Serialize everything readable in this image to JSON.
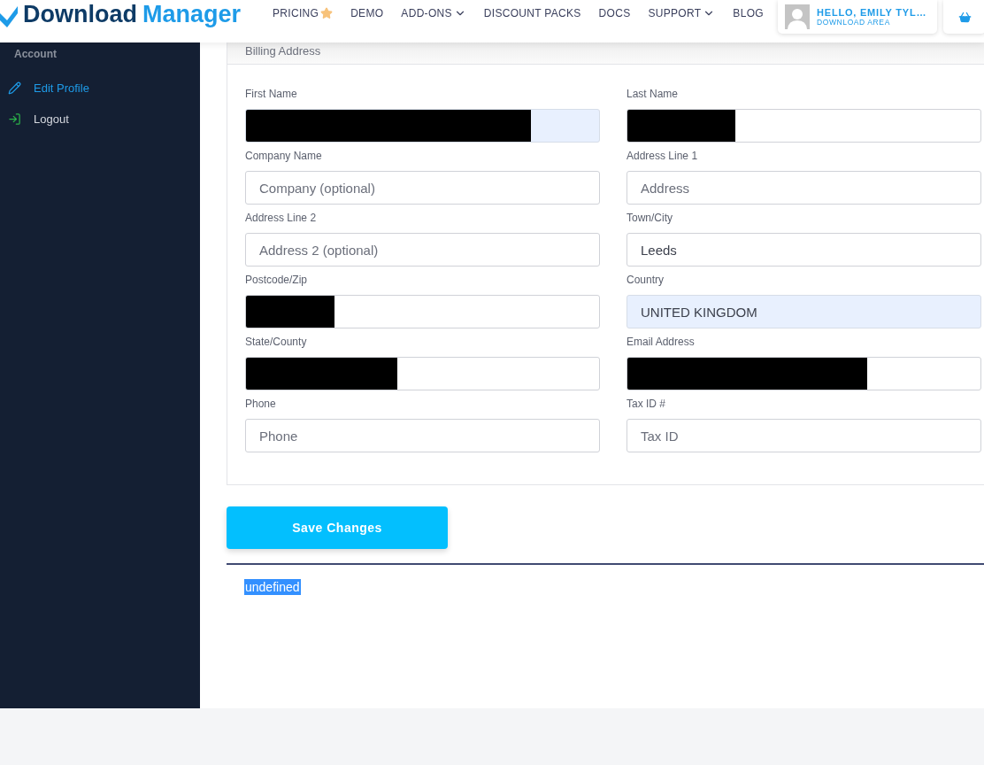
{
  "header": {
    "logo": {
      "first": "Download",
      "second": "Manager"
    },
    "nav": [
      {
        "label": "PRICING",
        "featured": true,
        "has_menu": false
      },
      {
        "label": "DEMO",
        "featured": false,
        "has_menu": false
      },
      {
        "label": "ADD-ONS",
        "featured": false,
        "has_menu": true
      },
      {
        "label": "DISCOUNT PACKS",
        "featured": false,
        "has_menu": false
      },
      {
        "label": "DOCS",
        "featured": false,
        "has_menu": false
      },
      {
        "label": "SUPPORT",
        "featured": false,
        "has_menu": true
      },
      {
        "label": "BLOG",
        "featured": false,
        "has_menu": false
      }
    ],
    "user": {
      "greeting": "HELLO, EMILY TYL…",
      "link": "DOWNLOAD AREA"
    }
  },
  "sidebar": {
    "heading": "Account",
    "items": [
      {
        "label": "Edit Profile",
        "kind": "edit",
        "selected": true
      },
      {
        "label": "Logout",
        "kind": "logout",
        "selected": false
      }
    ]
  },
  "form": {
    "title": "Billing Address",
    "fields": [
      {
        "label": "First Name",
        "autofilled": true,
        "redacted": true
      },
      {
        "label": "Last Name",
        "autofilled": false,
        "redacted": true
      },
      {
        "label": "Company Name",
        "placeholder": "Company (optional)",
        "autofilled": false,
        "redacted": false
      },
      {
        "label": "Address Line 1",
        "placeholder": "Address",
        "autofilled": false,
        "redacted": false
      },
      {
        "label": "Address Line 2",
        "placeholder": "Address 2 (optional)",
        "autofilled": false,
        "redacted": false
      },
      {
        "label": "Town/City",
        "value": "Leeds",
        "autofilled": false,
        "redacted": false
      },
      {
        "label": "Postcode/Zip",
        "autofilled": false,
        "redacted": true
      },
      {
        "label": "Country",
        "value": "UNITED KINGDOM",
        "autofilled": true,
        "redacted": false
      },
      {
        "label": "State/County",
        "autofilled": false,
        "redacted": true
      },
      {
        "label": "Email Address",
        "autofilled": false,
        "redacted": true
      },
      {
        "label": "Phone",
        "placeholder": "Phone",
        "autofilled": false,
        "redacted": false
      },
      {
        "label": "Tax ID #",
        "placeholder": "Tax ID",
        "autofilled": false,
        "redacted": false
      }
    ],
    "save_button": "Save Changes"
  },
  "output": {
    "text": "undefined",
    "selected": true
  }
}
